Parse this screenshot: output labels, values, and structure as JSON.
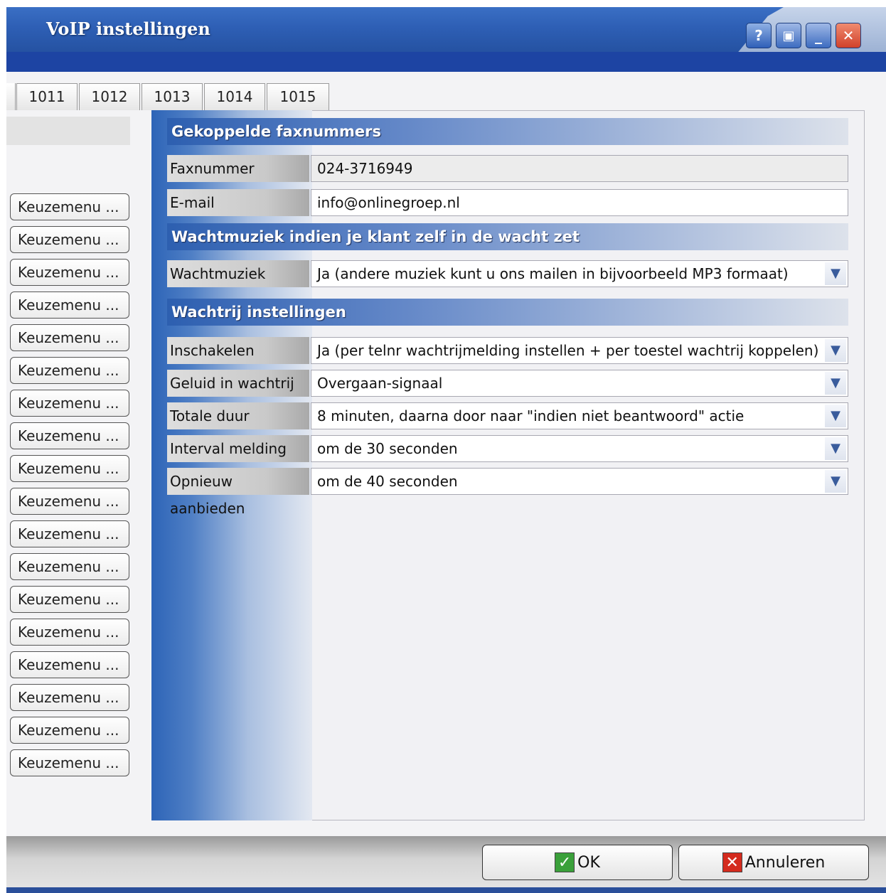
{
  "window": {
    "title": "VoIP instellingen",
    "buttons": {
      "help": "?",
      "restore": "▣",
      "minimize": "_",
      "close": "✕"
    }
  },
  "tabs": [
    "1011",
    "1012",
    "1013",
    "1014",
    "1015"
  ],
  "side_menu": {
    "items": [
      "Keuzemenu ...",
      "Keuzemenu ...",
      "Keuzemenu ...",
      "Keuzemenu ...",
      "Keuzemenu ...",
      "Keuzemenu ...",
      "Keuzemenu ...",
      "Keuzemenu ...",
      "Keuzemenu ...",
      "Keuzemenu ...",
      "Keuzemenu ...",
      "Keuzemenu ...",
      "Keuzemenu ...",
      "Keuzemenu ...",
      "Keuzemenu ...",
      "Keuzemenu ...",
      "Keuzemenu ...",
      "Keuzemenu ..."
    ]
  },
  "sections": {
    "fax": {
      "title": "Gekoppelde faxnummers",
      "faxnummer_label": "Faxnummer",
      "faxnummer_value": "024-3716949",
      "email_label": "E-mail",
      "email_value": "info@onlinegroep.nl"
    },
    "music": {
      "title": "Wachtmuziek indien je klant zelf in de wacht zet",
      "label": "Wachtmuziek",
      "value": "Ja (andere muziek kunt u ons mailen in bijvoorbeeld MP3 formaat)"
    },
    "queue": {
      "title": "Wachtrij instellingen",
      "rows": [
        {
          "label": "Inschakelen",
          "value": "Ja (per telnr wachtrijmelding instellen + per toestel wachtrij koppelen)"
        },
        {
          "label": "Geluid in wachtrij",
          "value": "Overgaan-signaal"
        },
        {
          "label": "Totale duur",
          "value": "8 minuten, daarna door naar \"indien niet beantwoord\" actie"
        },
        {
          "label": "Interval melding",
          "value": "om de 30 seconden"
        },
        {
          "label": "Opnieuw aanbieden",
          "value": "om de 40 seconden"
        }
      ]
    }
  },
  "footer": {
    "ok": "OK",
    "cancel": "Annuleren"
  },
  "colors": {
    "title_blue": "#2e5fb5",
    "nav_band": "#1d44a3",
    "ok_green": "#3aa03a",
    "cancel_red": "#d42b1e"
  },
  "icons": {
    "ok": "check-icon",
    "cancel": "x-icon",
    "dropdown": "chevron-down-icon"
  }
}
